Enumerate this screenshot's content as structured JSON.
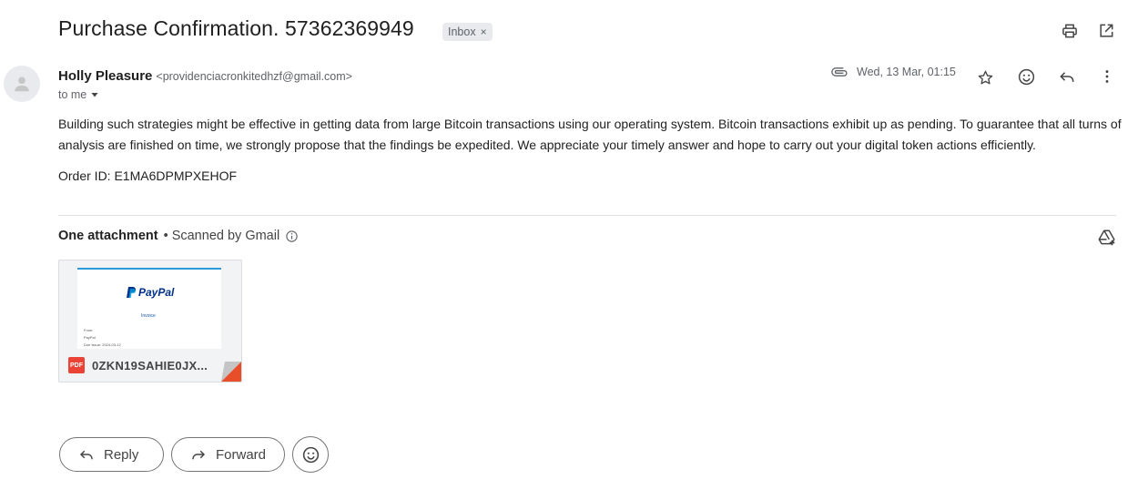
{
  "email": {
    "subject": "Purchase Confirmation. 57362369949",
    "label": "Inbox",
    "label_remove": "×",
    "sender_name": "Holly Pleasure",
    "sender_email": "<providenciacronkitedhzf@gmail.com>",
    "to_label": "to me",
    "date": "Wed, 13 Mar, 01:15",
    "body": "Building such strategies might be effective in getting data from large Bitcoin transactions using our operating system. Bitcoin transactions exhibit up as pending. To guarantee that all turns of analysis are finished on time, we strongly propose that the findings be expedited. We appreciate your timely answer and hope to carry out your digital token actions efficiently.",
    "order_line": "Order ID: E1MA6DPMPXEHOF"
  },
  "attachments": {
    "heading": "One attachment",
    "scanned": "• Scanned by Gmail",
    "file_name": "0ZKN19SAHIE0JX...",
    "file_type": "PDF",
    "preview": {
      "logo_text": "PayPal",
      "title": "Invoice",
      "line1": "From:",
      "line2": "PayPal",
      "line3": "Due Issue: 2024-03-12"
    }
  },
  "actions": {
    "reply": "Reply",
    "forward": "Forward"
  },
  "colors": {
    "chip_bg": "#e8eaed",
    "pdf_red": "#ea4335",
    "paypal_dark": "#003087",
    "paypal_light": "#009cde"
  }
}
